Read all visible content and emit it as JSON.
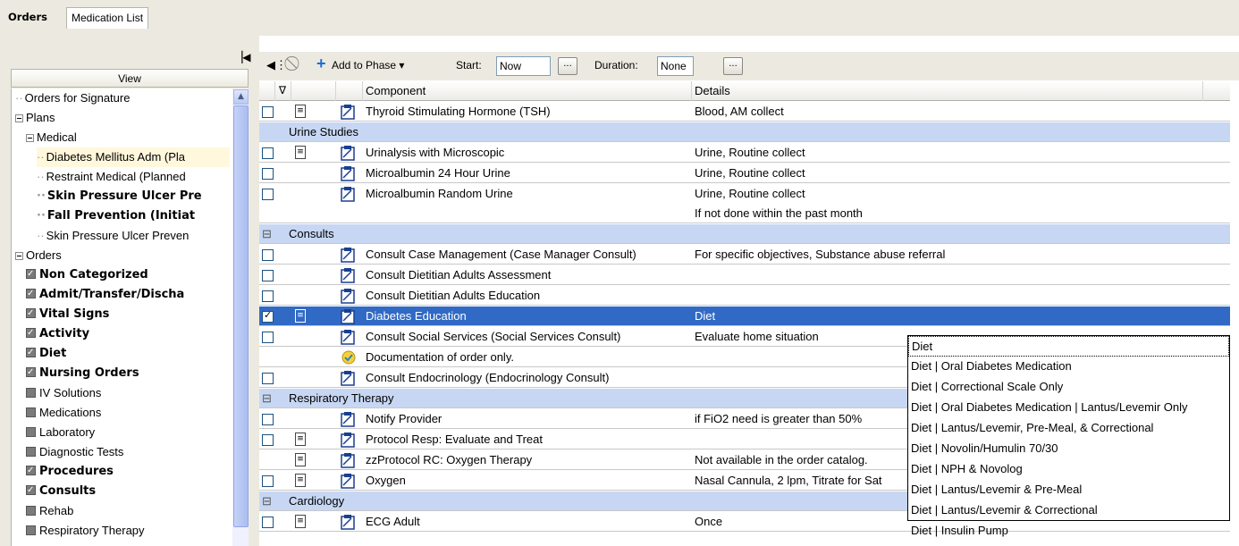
{
  "tabs": {
    "orders": "Orders",
    "medlist": "Medication List"
  },
  "left": {
    "view_header": "View",
    "tree": [
      {
        "label": "Orders for Signature",
        "indent": 0,
        "kind": "leaf"
      },
      {
        "label": "Plans",
        "indent": 0,
        "kind": "exp"
      },
      {
        "label": "Medical",
        "indent": 1,
        "kind": "exp"
      },
      {
        "label": "Diabetes Mellitus  Adm (Pla",
        "indent": 2,
        "kind": "leaf",
        "highlight": true
      },
      {
        "label": "Restraint Medical (Planned",
        "indent": 2,
        "kind": "leaf"
      },
      {
        "label": "Skin Pressure Ulcer Pre",
        "indent": 2,
        "kind": "leaf",
        "bold": true
      },
      {
        "label": "Fall Prevention (Initiat",
        "indent": 2,
        "kind": "leaf",
        "bold": true
      },
      {
        "label": "Skin Pressure Ulcer Preven",
        "indent": 2,
        "kind": "leaf"
      },
      {
        "label": "Orders",
        "indent": 0,
        "kind": "exp"
      },
      {
        "label": "Non Categorized",
        "indent": 1,
        "kind": "chk",
        "bold": true
      },
      {
        "label": "Admit/Transfer/Discha",
        "indent": 1,
        "kind": "chk",
        "bold": true
      },
      {
        "label": "Vital Signs",
        "indent": 1,
        "kind": "chk",
        "bold": true
      },
      {
        "label": "Activity",
        "indent": 1,
        "kind": "chk",
        "bold": true
      },
      {
        "label": "Diet",
        "indent": 1,
        "kind": "chk",
        "bold": true
      },
      {
        "label": "Nursing Orders",
        "indent": 1,
        "kind": "chk",
        "bold": true
      },
      {
        "label": "IV Solutions",
        "indent": 1,
        "kind": "box"
      },
      {
        "label": "Medications",
        "indent": 1,
        "kind": "box"
      },
      {
        "label": "Laboratory",
        "indent": 1,
        "kind": "box"
      },
      {
        "label": "Diagnostic Tests",
        "indent": 1,
        "kind": "box"
      },
      {
        "label": "Procedures",
        "indent": 1,
        "kind": "chk",
        "bold": true
      },
      {
        "label": "Consults",
        "indent": 1,
        "kind": "chk",
        "bold": true
      },
      {
        "label": "Rehab",
        "indent": 1,
        "kind": "box"
      },
      {
        "label": "Respiratory Therapy",
        "indent": 1,
        "kind": "box"
      }
    ]
  },
  "toolbar": {
    "add_to_phase": "Add to Phase",
    "start_label": "Start:",
    "start_value": "Now",
    "duration_label": "Duration:",
    "duration_value": "None"
  },
  "grid": {
    "columns": [
      "Component",
      "Details"
    ],
    "rows": [
      {
        "type": "order",
        "check": false,
        "icon": true,
        "component": "Thyroid Stimulating Hormone (TSH)",
        "details": "Blood, AM collect",
        "btn": true
      },
      {
        "type": "section",
        "label": "Urine Studies",
        "expander": false
      },
      {
        "type": "order",
        "check": false,
        "icon": true,
        "component": "Urinalysis with Microscopic",
        "details": "Urine, Routine collect",
        "btn": true
      },
      {
        "type": "order",
        "check": false,
        "icon": false,
        "component": "Microalbumin 24 Hour Urine",
        "details": "Urine, Routine collect",
        "btn": true
      },
      {
        "type": "order",
        "check": false,
        "icon": false,
        "component": "Microalbumin Random Urine",
        "details": "Urine, Routine collect",
        "details2": "If not done within the past month",
        "btn": true,
        "tall": true
      },
      {
        "type": "section",
        "label": "Consults",
        "expander": true
      },
      {
        "type": "order",
        "check": false,
        "icon": false,
        "component": "Consult Case Management (Case Manager Consult)",
        "details": "For specific objectives, Substance abuse referral",
        "btn": true
      },
      {
        "type": "order",
        "check": false,
        "icon": false,
        "component": "Consult Dietitian Adults Assessment",
        "details": "",
        "btn": false
      },
      {
        "type": "order",
        "check": false,
        "icon": false,
        "component": "Consult Dietitian Adults Education",
        "details": "",
        "btn": false
      },
      {
        "type": "order",
        "check": true,
        "icon": true,
        "selected": true,
        "component": "Diabetes Education",
        "details": "Diet",
        "btn": true
      },
      {
        "type": "order",
        "check": false,
        "icon": false,
        "component": "Consult Social Services (Social Services Consult)",
        "details": "Evaluate home situation",
        "btn": false
      },
      {
        "type": "order",
        "nocheck": true,
        "icon": false,
        "special": true,
        "component": "Documentation of order only.",
        "details": "",
        "btn": false
      },
      {
        "type": "order",
        "check": false,
        "icon": false,
        "component": "Consult Endocrinology (Endocrinology Consult)",
        "details": "",
        "btn": false
      },
      {
        "type": "section",
        "label": "Respiratory Therapy",
        "expander": true
      },
      {
        "type": "order",
        "check": false,
        "icon": false,
        "component": "Notify Provider",
        "details": "if FiO2 need is greater than 50%",
        "btn": false
      },
      {
        "type": "order",
        "check": false,
        "icon": true,
        "component": "Protocol Resp: Evaluate and Treat",
        "details": "",
        "btn": false
      },
      {
        "type": "order",
        "nocheck": true,
        "icon": true,
        "component": "zzProtocol RC: Oxygen Therapy",
        "details": "Not available in the order catalog.",
        "btn": false
      },
      {
        "type": "order",
        "check": false,
        "icon": true,
        "component": "Oxygen",
        "details": "Nasal Cannula, 2 lpm, Titrate for Sat",
        "btn": false
      },
      {
        "type": "section",
        "label": "Cardiology",
        "expander": true
      },
      {
        "type": "order",
        "check": false,
        "icon": true,
        "component": "ECG Adult",
        "details": "Once",
        "btn": true
      }
    ]
  },
  "dropdown": [
    "Diet",
    "Diet | Oral Diabetes Medication",
    "Diet | Correctional Scale Only",
    "Diet | Oral Diabetes Medication | Lantus/Levemir Only",
    "Diet | Lantus/Levemir, Pre-Meal, & Correctional",
    "Diet | Novolin/Humulin 70/30",
    "Diet | NPH & Novolog",
    "Diet | Lantus/Levemir & Pre-Meal",
    "Diet | Lantus/Levemir & Correctional",
    "Diet | Insulin Pump"
  ]
}
